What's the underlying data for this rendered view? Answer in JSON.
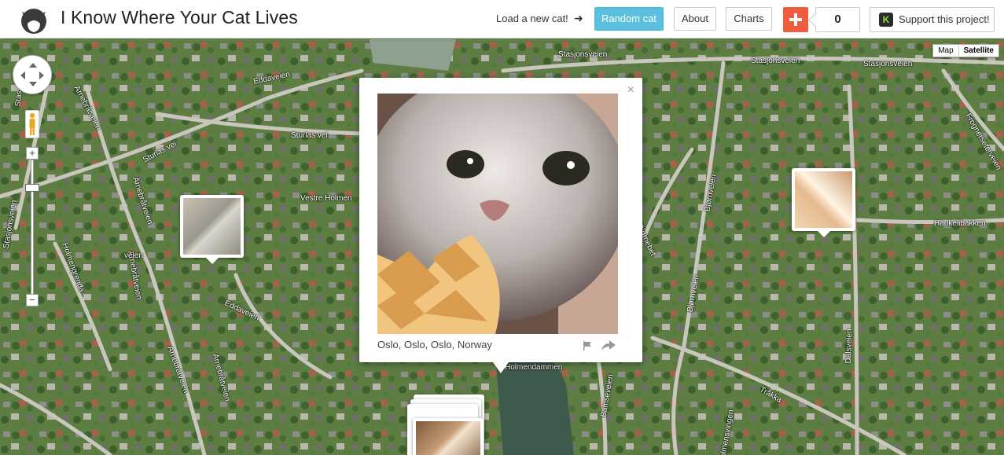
{
  "header": {
    "title": "I Know Where Your Cat Lives",
    "logo_icon": "cat-head-icon",
    "load_text": "Load a new cat!",
    "arrow_icon": "arrow-right-icon",
    "random_label": "Random cat",
    "about_label": "About",
    "charts_label": "Charts",
    "plus_icon": "plus-icon",
    "count": "0",
    "support_icon": "kickstarter-icon",
    "support_icon_letter": "K",
    "support_label": "Support this project!"
  },
  "map": {
    "type_map": "Map",
    "type_satellite": "Satellite",
    "active_type": "Satellite",
    "zoom_in": "+",
    "zoom_out": "−",
    "road_labels": {
      "stasjonsveien_top": "Stasjonsveien",
      "stasjonsveien_right": "Stasjonsveien",
      "eddaveien_top": "Eddaveien",
      "sturlas_vei_1": "Sturlas vei",
      "sturlas_vei_2": "Sturlas vei",
      "vestre_holmen": "Vestre Holmen",
      "arnebratveien_1": "Arnebråtveien",
      "arnebratveien_2": "Arnebråtveien",
      "arnebratveien_3": "Arnebråtveien",
      "arnebratveien_4": "Arnebråtveien",
      "stasjonsveien_left": "Stasjonsveien",
      "holmengrenda": "Holmengrenda",
      "eddaveien_mid": "Eddaveien",
      "veien": "veien",
      "bjornveien_1": "Bjørnveien",
      "bjornveien_2": "Bjørnveien",
      "bjornebet": "Bjørnebet",
      "haukelibakken": "Haukelibakken",
      "frognerseterveien": "Frognerseterveien",
      "dalsveien": "Dalsveien",
      "trakka": "Tråkka",
      "bamseveien": "Bamseveien",
      "holmensvingen": "Holmensvingen",
      "holmendammen": "Holmendammen",
      "stas_top": "Stas"
    }
  },
  "popup": {
    "close": "×",
    "location": "Oslo, Oslo, Oslo, Norway",
    "flag_icon": "flag-icon",
    "share_icon": "share-icon"
  },
  "colors": {
    "accent_random": "#5bc0de",
    "plus_bg": "#ee5b3e",
    "kickstarter_green": "#8be04e"
  }
}
